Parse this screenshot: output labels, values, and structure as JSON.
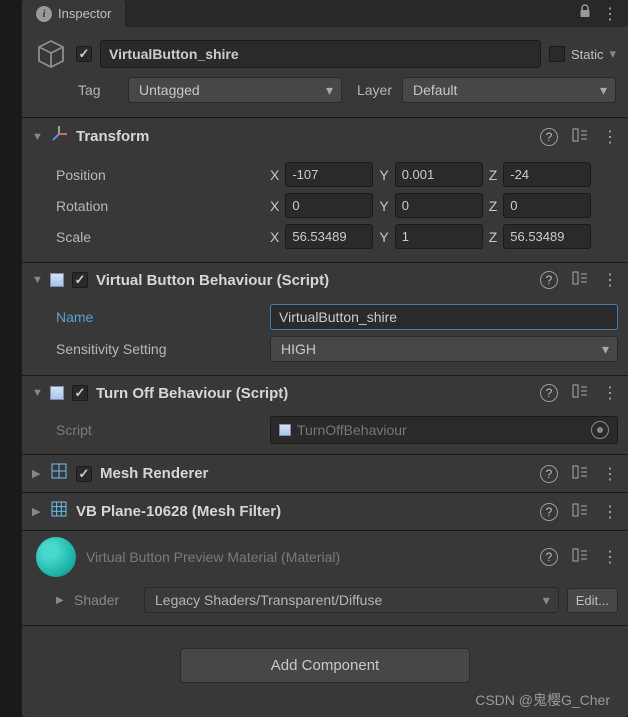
{
  "tab": {
    "title": "Inspector"
  },
  "header": {
    "enabled": true,
    "name": "VirtualButton_shire",
    "static_label": "Static",
    "static_checked": false,
    "tag_label": "Tag",
    "tag_value": "Untagged",
    "layer_label": "Layer",
    "layer_value": "Default"
  },
  "transform": {
    "title": "Transform",
    "position": {
      "label": "Position",
      "x": "-107",
      "y": "0.001",
      "z": "-24"
    },
    "rotation": {
      "label": "Rotation",
      "x": "0",
      "y": "0",
      "z": "0"
    },
    "scale": {
      "label": "Scale",
      "x": "56.53489",
      "y": "1",
      "z": "56.53489"
    },
    "axes": {
      "x": "X",
      "y": "Y",
      "z": "Z"
    }
  },
  "vbb": {
    "title": "Virtual Button Behaviour (Script)",
    "name_label": "Name",
    "name_value": "VirtualButton_shire",
    "sensitivity_label": "Sensitivity Setting",
    "sensitivity_value": "HIGH"
  },
  "tob": {
    "title": "Turn Off Behaviour (Script)",
    "script_label": "Script",
    "script_value": "TurnOffBehaviour"
  },
  "mesh_renderer": {
    "title": "Mesh Renderer"
  },
  "mesh_filter": {
    "title": "VB Plane-10628 (Mesh Filter)"
  },
  "material": {
    "title": "Virtual Button Preview Material (Material)",
    "shader_label": "Shader",
    "shader_value": "Legacy Shaders/Transparent/Diffuse",
    "edit_label": "Edit..."
  },
  "add_component": "Add Component",
  "watermark": "CSDN @鬼樱G_Cher"
}
